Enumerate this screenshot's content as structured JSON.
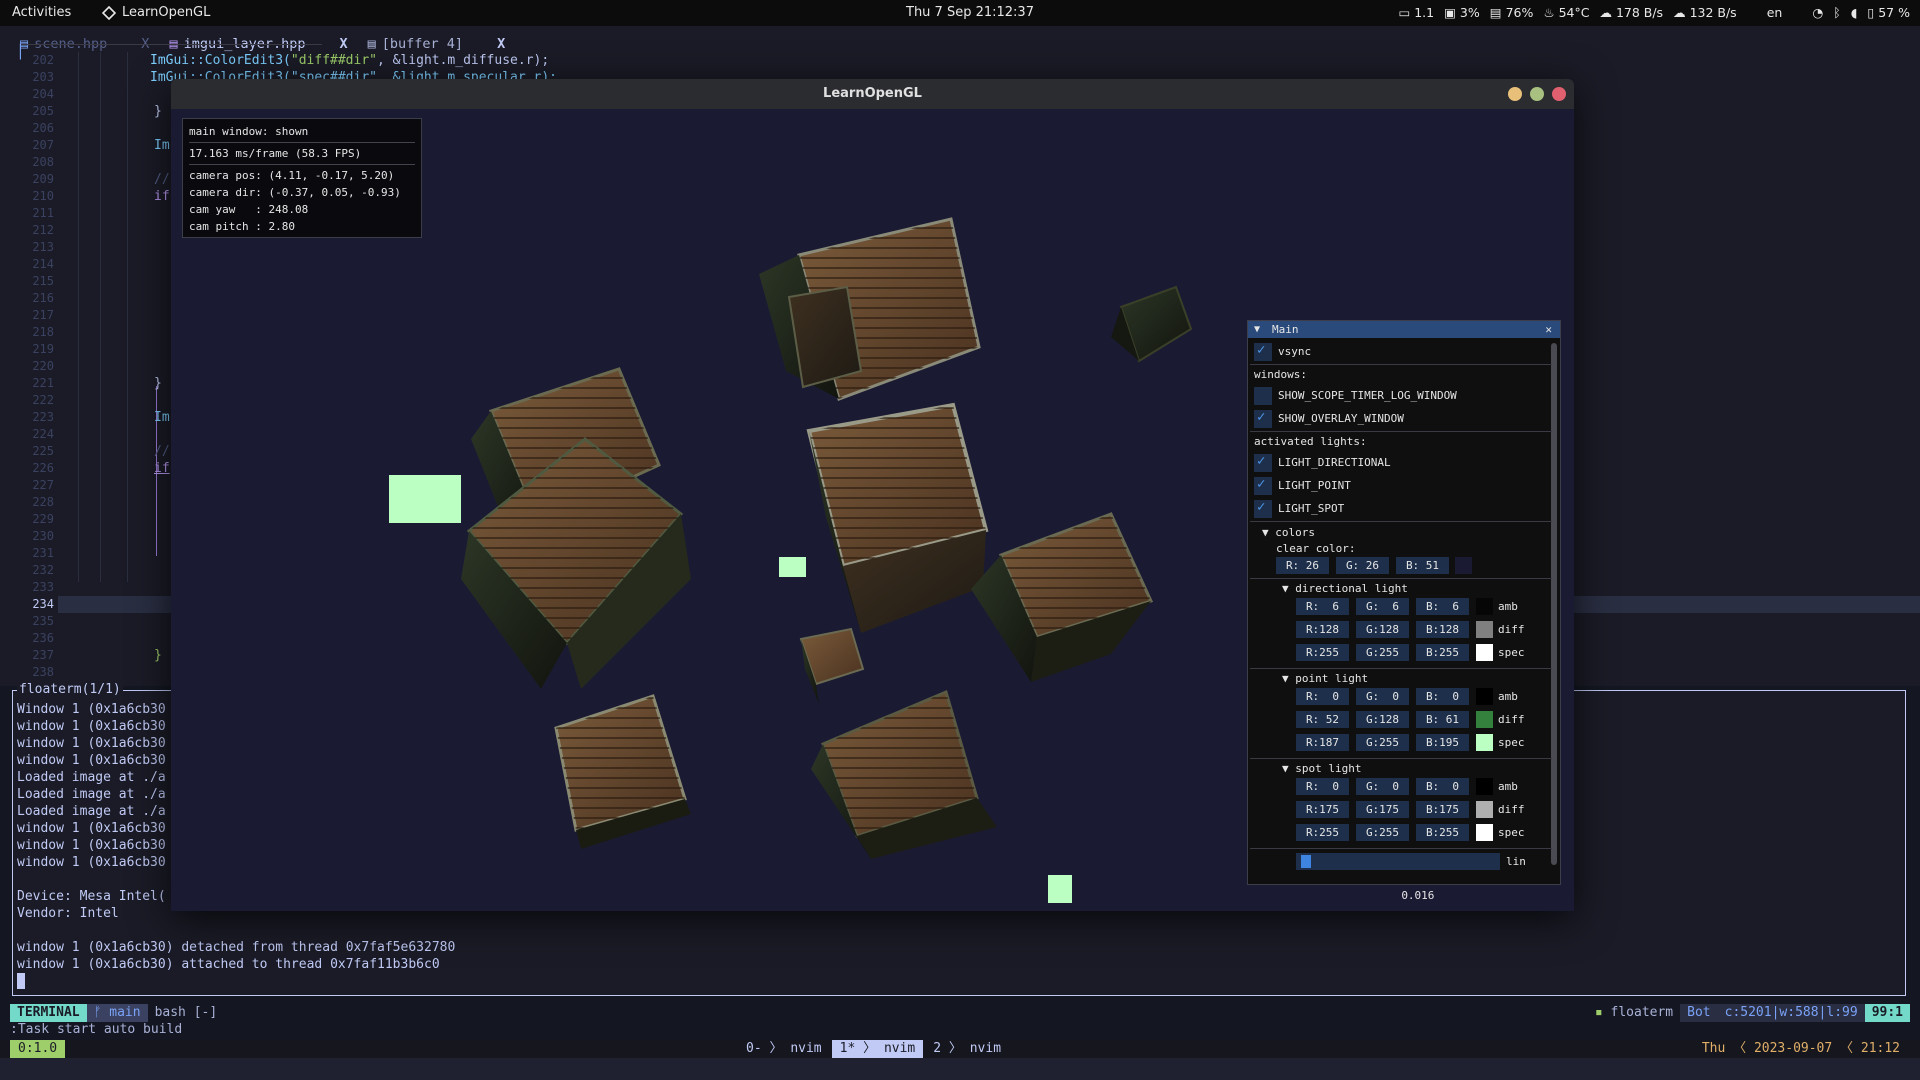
{
  "topbar": {
    "activities": "Activities",
    "app_name": "LearnOpenGL",
    "clock": "Thu 7 Sep  21:12:37",
    "tray": [
      "1.1",
      "3%",
      "76%",
      "54°C",
      "178 B/s",
      "132 B/s",
      "en",
      "57 %"
    ]
  },
  "editor": {
    "tabs": [
      {
        "label": "scene.hpp",
        "close": "X",
        "active": false
      },
      {
        "label": "imgui_layer.hpp",
        "close": "X",
        "active": true
      },
      {
        "label": "[buffer 4]",
        "close": "X",
        "active": false
      }
    ],
    "line_numbers": [
      "202",
      "203",
      "204",
      "205",
      "206",
      "207",
      "208",
      "209",
      "210",
      "211",
      "212",
      "213",
      "214",
      "215",
      "216",
      "217",
      "218",
      "219",
      "220",
      "221",
      "222",
      "223",
      "224",
      "225",
      "226",
      "227",
      "228",
      "229",
      "230",
      "231",
      "232",
      "233",
      "234",
      "235",
      "236",
      "237",
      "238"
    ],
    "current_line": "234",
    "code": {
      "l202_fn": "ImGui::ColorEdit3(",
      "l202_str": "\"diff##dir\"",
      "l202_rest": ", &light.m_diffuse.r);",
      "l203": "ImGui::ColorEdit3(\"spec##dir\", &light.m_specular.r);",
      "l205": "}",
      "l207": "Im",
      "l209": "//",
      "l210": "if",
      "l221": "}",
      "l223": "Im",
      "l225": "//",
      "l226": "if",
      "l237": "}"
    }
  },
  "floaterm": {
    "title": "floaterm(1/1)",
    "lines": [
      "Window 1 (0x1a6cb30",
      "window 1 (0x1a6cb30",
      "window 1 (0x1a6cb30",
      "window 1 (0x1a6cb30",
      "Loaded image at ./a",
      "Loaded image at ./a",
      "Loaded image at ./a",
      "window 1 (0x1a6cb30",
      "window 1 (0x1a6cb30",
      "window 1 (0x1a6cb30",
      "",
      "Device: Mesa Intel(",
      "Vendor: Intel",
      "",
      "window 1 (0x1a6cb30) detached from thread 0x7faf5e632780",
      "window 1 (0x1a6cb30) attached to thread 0x7faf11b3b6c0"
    ]
  },
  "statusline": {
    "mode": "TERMINAL",
    "branch": "main",
    "shell": "bash [-]",
    "right_name": "floaterm",
    "bot": "Bot",
    "pos": "c:5201|w:588|l:99",
    "linecol": "99:1"
  },
  "cmdline": ":Task start auto build",
  "tmux": {
    "session": "0:1.0",
    "windows": [
      {
        "index": "0-",
        "name": "nvim",
        "active": false
      },
      {
        "index": "1*",
        "name": "nvim",
        "active": true
      },
      {
        "index": "2",
        "name": "nvim",
        "active": false
      }
    ],
    "right": "Thu  〈 2023-09-07 〈 21:12"
  },
  "glwindow": {
    "title": "LearnOpenGL",
    "colors": {
      "clear": "#1a1a33",
      "point_light": "#bbffc3"
    },
    "overlay": {
      "line1": "main window: shown",
      "line2": "17.163 ms/frame (58.3 FPS)",
      "line3": "camera pos: (4.11, -0.17, 5.20)",
      "line4": "camera dir: (-0.37, 0.05, -0.93)",
      "line5": "cam yaw   : 248.08",
      "line6": "cam pitch : 2.80"
    }
  },
  "imgui": {
    "title": "Main",
    "vsync": "vsync",
    "windows_label": "windows:",
    "show_scope": "SHOW_SCOPE_TIMER_LOG_WINDOW",
    "show_overlay": "SHOW_OVERLAY_WINDOW",
    "activated_label": "activated lights:",
    "light_dir": "LIGHT_DIRECTIONAL",
    "light_point": "LIGHT_POINT",
    "light_spot": "LIGHT_SPOT",
    "colors_label": "colors",
    "clear_label": "clear color:",
    "clear": {
      "r": "R: 26",
      "g": "G: 26",
      "b": "B: 51"
    },
    "dir_label": "directional light",
    "point_label": "point light",
    "spot_label": "spot light",
    "amb": "amb",
    "diff": "diff",
    "spec": "spec",
    "dir": {
      "amb": [
        "R:  6",
        "G:  6",
        "B:  6"
      ],
      "amb_color": "#060606",
      "diff": [
        "R:128",
        "G:128",
        "B:128"
      ],
      "diff_color": "#808080",
      "spec": [
        "R:255",
        "G:255",
        "B:255"
      ],
      "spec_color": "#ffffff"
    },
    "point": {
      "amb": [
        "R:  0",
        "G:  0",
        "B:  0"
      ],
      "amb_color": "#000000",
      "diff": [
        "R: 52",
        "G:128",
        "B: 61"
      ],
      "diff_color": "#34803d",
      "spec": [
        "R:187",
        "G:255",
        "B:195"
      ],
      "spec_color": "#bbffc3"
    },
    "spot": {
      "amb": [
        "R:  0",
        "G:  0",
        "B:  0"
      ],
      "amb_color": "#000000",
      "diff": [
        "R:175",
        "G:175",
        "B:175"
      ],
      "diff_color": "#afafaf",
      "spec": [
        "R:255",
        "G:255",
        "B:255"
      ],
      "spec_color": "#ffffff"
    },
    "lin_value": "0.016",
    "lin_label": "lin"
  }
}
